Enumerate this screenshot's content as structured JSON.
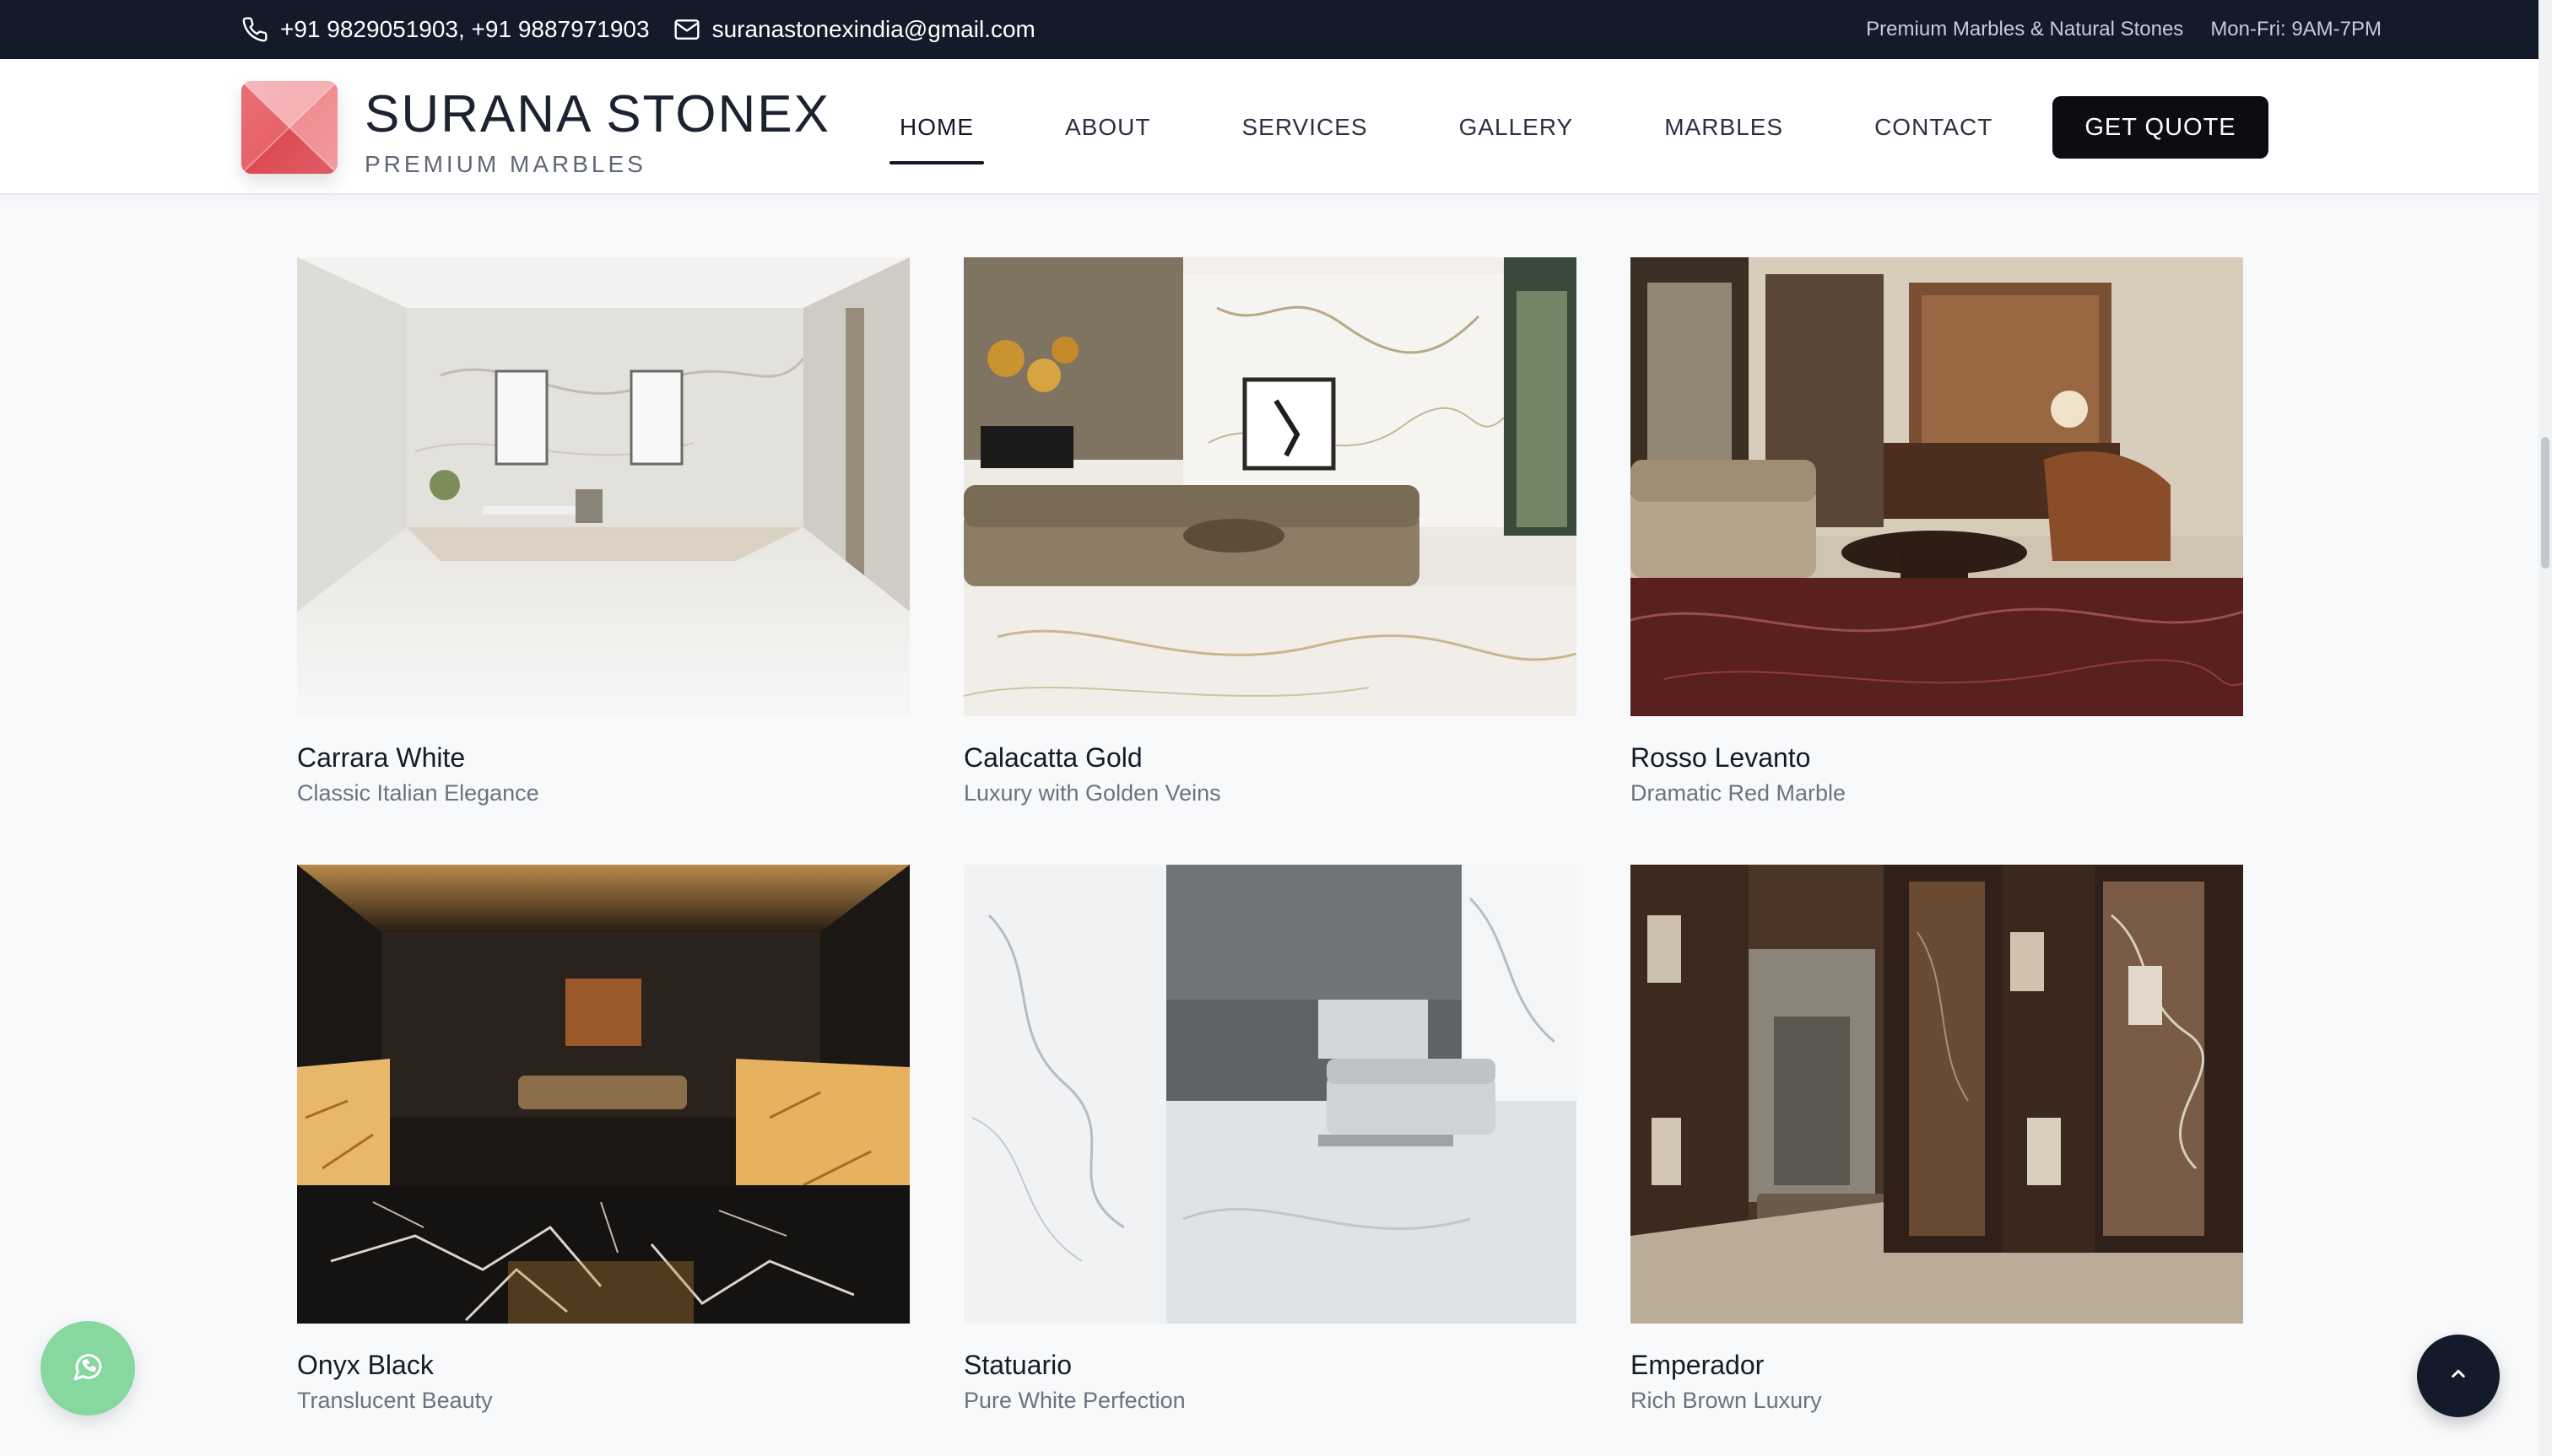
{
  "topbar": {
    "phone": "+91 9829051903, +91 9887971903",
    "email": "suranastonexindia@gmail.com",
    "tagline": "Premium Marbles & Natural Stones",
    "hours": "Mon-Fri: 9AM-7PM"
  },
  "brand": {
    "name": "SURANA STONEX",
    "tagline": "PREMIUM MARBLES"
  },
  "nav": {
    "items": [
      {
        "label": "HOME",
        "active": true
      },
      {
        "label": "ABOUT"
      },
      {
        "label": "SERVICES"
      },
      {
        "label": "GALLERY"
      },
      {
        "label": "MARBLES"
      },
      {
        "label": "CONTACT"
      }
    ],
    "cta": "GET QUOTE"
  },
  "gallery": {
    "items": [
      {
        "title": "Carrara White",
        "subtitle": "Classic Italian Elegance"
      },
      {
        "title": "Calacatta Gold",
        "subtitle": "Luxury with Golden Veins"
      },
      {
        "title": "Rosso Levanto",
        "subtitle": "Dramatic Red Marble"
      },
      {
        "title": "Onyx Black",
        "subtitle": "Translucent Beauty"
      },
      {
        "title": "Statuario",
        "subtitle": "Pure White Perfection"
      },
      {
        "title": "Emperador",
        "subtitle": "Rich Brown Luxury"
      }
    ]
  },
  "colors": {
    "topbar_bg": "#131a2a",
    "accent": "#0b0d12",
    "whatsapp": "#87d7a0"
  },
  "icons": {
    "phone": "phone-icon",
    "email": "mail-icon",
    "whatsapp": "whatsapp-icon",
    "scroll_top": "chevron-up-icon"
  }
}
